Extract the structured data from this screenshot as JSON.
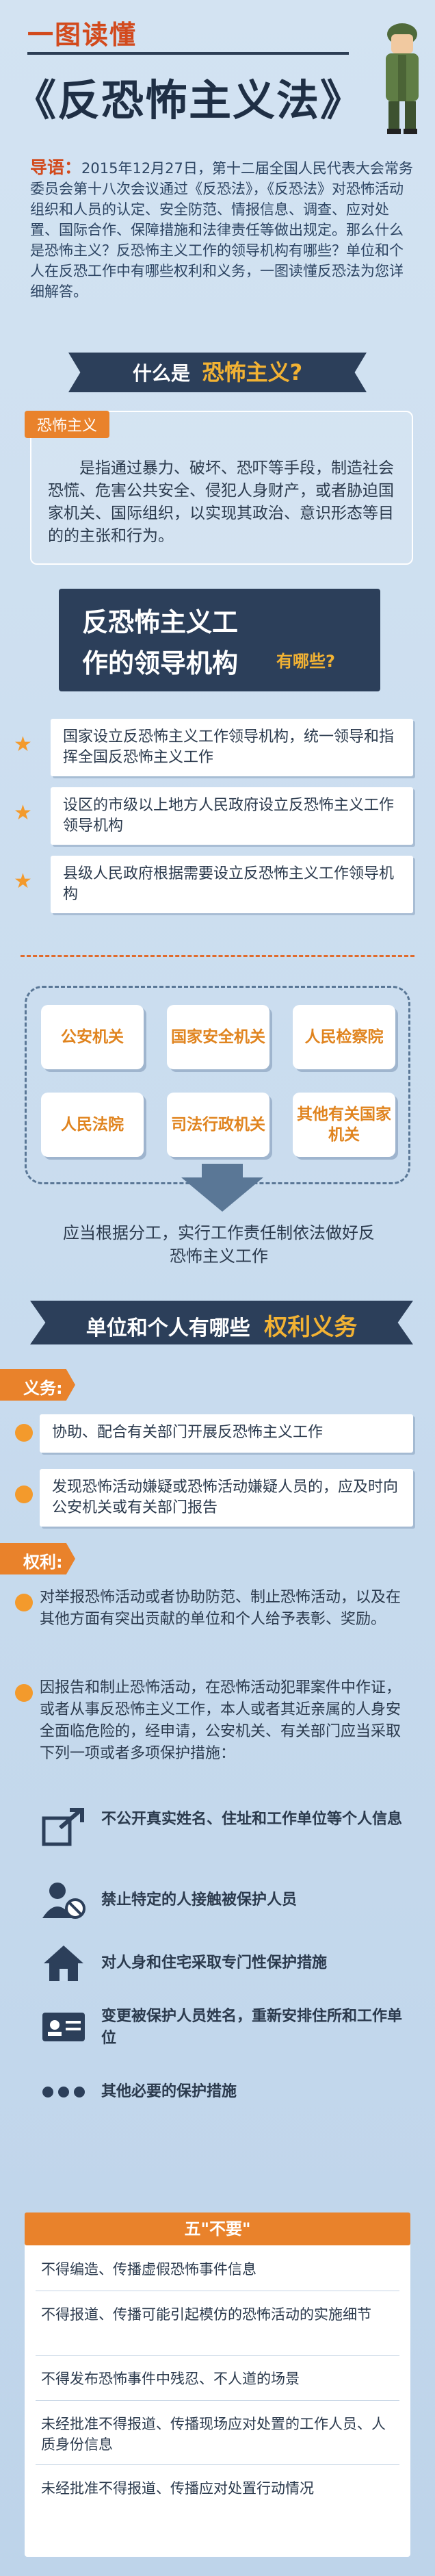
{
  "header": {
    "brand": "一图读懂",
    "title": "《反恐怖主义法》"
  },
  "intro": {
    "label": "导语：",
    "text": "2015年12月27日，第十二届全国人民代表大会常务委员会第十八次会议通过《反恐法》，《反恐法》对恐怖活动组织和人员的认定、安全防范、情报信息、调查、应对处置、国际合作、保障措施和法律责任等做出规定。那么什么是恐怖主义？反恐怖主义工作的领导机构有哪些？单位和个人在反恐工作中有哪些权利和义务，一图读懂反恐法为您详细解答。"
  },
  "definition": {
    "head_prefix": "什么是",
    "head_highlight": "恐怖主义?",
    "tag": "恐怖主义",
    "text": "是指通过暴力、破坏、恐吓等手段，制造社会恐慌、危害公共安全、侵犯人身财产，或者胁迫国家机关、国际组织，以实现其政治、意识形态等目的的主张和行为。"
  },
  "leadership": {
    "title_line1": "反恐怖主义工",
    "title_line2": "作的领导机构",
    "title_q": "有哪些?",
    "items": [
      "国家设立反恐怖主义工作领导机构，统一领导和指挥全国反恐怖主义工作",
      "设区的市级以上地方人民政府设立反恐怖主义工作领导机构",
      "县级人民政府根据需要设立反恐怖主义工作领导机构"
    ],
    "orgs": [
      "公安机关",
      "国家安全机关",
      "人民检察院",
      "人民法院",
      "司法行政机关",
      "其他有关国家机关"
    ],
    "note": "应当根据分工，实行工作责任制依法做好反恐怖主义工作"
  },
  "rights": {
    "head_prefix": "单位和个人有哪些",
    "head_highlight": "权利义务",
    "duty_tag": "义务:",
    "duties": [
      "协助、配合有关部门开展反恐怖主义工作",
      "发现恐怖活动嫌疑或恐怖活动嫌疑人员的，应及时向公安机关或有关部门报告"
    ],
    "right_tag": "权利:",
    "rights": [
      "对举报恐怖活动或者协助防范、制止恐怖活动，以及在其他方面有突出贡献的单位和个人给予表彰、奖励。",
      "因报告和制止恐怖活动，在恐怖活动犯罪案件中作证，或者从事反恐怖主义工作，本人或者其近亲属的人身安全面临危险的，经申请，公安机关、有关部门应当采取下列一项或者多项保护措施："
    ],
    "protections": [
      "不公开真实姓名、住址和工作单位等个人信息",
      "禁止特定的人接触被保护人员",
      "对人身和住宅采取专门性保护措施",
      "变更被保护人员姓名，重新安排住所和工作单位",
      "其他必要的保护措施"
    ],
    "protection_icons": [
      "share-export-icon",
      "person-ban-icon",
      "house-icon",
      "id-card-icon",
      "more-dots-icon"
    ]
  },
  "five_nots": {
    "title": "五\"不要\"",
    "items": [
      "不得编造、传播虚假恐怖事件信息",
      "不得报道、传播可能引起模仿的恐怖活动的实施细节",
      "不得发布恐怖事件中残忍、不人道的场景",
      "未经批准不得报道、传播现场应对处置的工作人员、人质身份信息",
      "未经批准不得报道、传播应对处置行动情况"
    ]
  },
  "colors": {
    "accent_orange": "#e9822b",
    "navy": "#2c3f5a",
    "title_red": "#d24a1d",
    "highlight_gold": "#f2b233"
  }
}
